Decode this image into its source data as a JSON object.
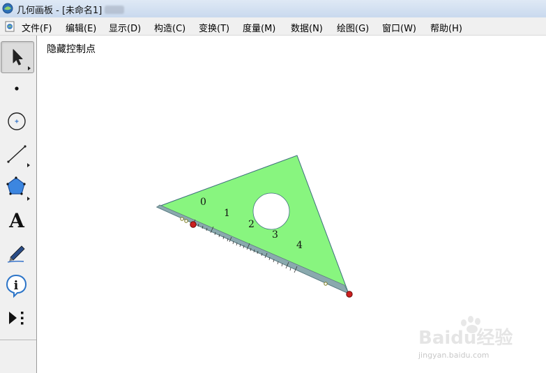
{
  "window": {
    "title": "几何画板 - [未命名1]"
  },
  "menu": {
    "items": [
      "文件(F)",
      "编辑(E)",
      "显示(D)",
      "构造(C)",
      "变换(T)",
      "度量(M)",
      "数据(N)",
      "绘图(G)",
      "窗口(W)",
      "帮助(H)"
    ]
  },
  "toolbox": {
    "tools": [
      {
        "name": "arrow-select-tool",
        "icon": "arrow-icon",
        "active": true
      },
      {
        "name": "point-tool",
        "icon": "point-icon"
      },
      {
        "name": "compass-tool",
        "icon": "compass-circle-icon"
      },
      {
        "name": "straightedge-tool",
        "icon": "line-segment-icon"
      },
      {
        "name": "polygon-tool",
        "icon": "pentagon-icon"
      },
      {
        "name": "text-tool",
        "icon": "text-A-icon",
        "label": "A"
      },
      {
        "name": "marker-tool",
        "icon": "pen-icon"
      },
      {
        "name": "information-tool",
        "icon": "info-icon",
        "label": "i"
      },
      {
        "name": "custom-tool",
        "icon": "play-custom-icon"
      }
    ]
  },
  "canvas": {
    "hide_control_points_button": "隐藏控制点",
    "set_square": {
      "fill_color": "#88f57f",
      "scale_band_color": "#8aa9ae",
      "hole_color": "#ffffff",
      "control_point_color": "#cc1f1f",
      "scale_labels": [
        "0",
        "1",
        "2",
        "3",
        "4"
      ]
    }
  },
  "watermark": {
    "text": "Baidu经验",
    "url": "jingyan.baidu.com"
  }
}
